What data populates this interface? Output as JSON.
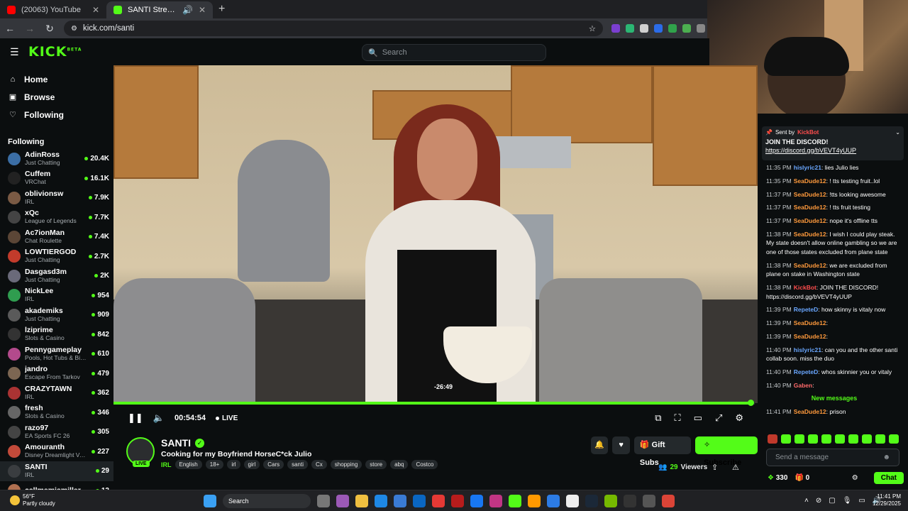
{
  "browser": {
    "tabs": [
      {
        "title": "(20063) YouTube",
        "favicon": "youtube-icon",
        "color": "#ff0000",
        "active": false
      },
      {
        "title": "SANTI Stream - Watch Live",
        "favicon": "kick-icon",
        "color": "#53fc18",
        "active": true
      }
    ],
    "url": "kick.com/santi"
  },
  "header": {
    "logo": "KICK",
    "logo_tag": "BETA",
    "search_placeholder": "Search"
  },
  "sidebar": {
    "nav": [
      {
        "label": "Home",
        "icon": "home-icon"
      },
      {
        "label": "Browse",
        "icon": "browse-icon"
      },
      {
        "label": "Following",
        "icon": "heart-icon"
      }
    ],
    "following_title": "Following",
    "channels": [
      {
        "name": "AdinRoss",
        "category": "Just Chatting",
        "viewers": "20.4K",
        "color": "#3b6ea5"
      },
      {
        "name": "Cuffem",
        "category": "VRChat",
        "viewers": "16.1K",
        "color": "#222"
      },
      {
        "name": "oblivionsw",
        "category": "IRL",
        "viewers": "7.9K",
        "color": "#7a5a44"
      },
      {
        "name": "xQc",
        "category": "League of Legends",
        "viewers": "7.7K",
        "color": "#444"
      },
      {
        "name": "Ac7ionMan",
        "category": "Chat Roulette",
        "viewers": "7.4K",
        "color": "#5b4636"
      },
      {
        "name": "LOWTIERGOD",
        "category": "Just Chatting",
        "viewers": "2.7K",
        "color": "#c23b2b"
      },
      {
        "name": "Dasgasd3m",
        "category": "Just Chatting",
        "viewers": "2K",
        "color": "#6a6a7a"
      },
      {
        "name": "NickLee",
        "category": "IRL",
        "viewers": "954",
        "color": "#2f9d4f"
      },
      {
        "name": "akademiks",
        "category": "Just Chatting",
        "viewers": "909",
        "color": "#5a5a5a"
      },
      {
        "name": "lziprime",
        "category": "Slots & Casino",
        "viewers": "842",
        "color": "#333"
      },
      {
        "name": "Pennygameplay",
        "category": "Pools, Hot Tubs & Biki...",
        "viewers": "610",
        "color": "#b34a8c"
      },
      {
        "name": "jandro",
        "category": "Escape From Tarkov",
        "viewers": "479",
        "color": "#7c6652"
      },
      {
        "name": "CRAZYTAWN",
        "category": "IRL",
        "viewers": "362",
        "color": "#a33"
      },
      {
        "name": "fresh",
        "category": "Slots & Casino",
        "viewers": "346",
        "color": "#666"
      },
      {
        "name": "razo97",
        "category": "EA Sports FC 26",
        "viewers": "305",
        "color": "#444"
      },
      {
        "name": "Amouranth",
        "category": "Disney Dreamlight Vall...",
        "viewers": "227",
        "color": "#c24a3a"
      },
      {
        "name": "SANTI",
        "category": "IRL",
        "viewers": "29",
        "color": "#3a3d40",
        "selected": true
      },
      {
        "name": "callmemiamiller",
        "category": "",
        "viewers": "12",
        "color": "#b07050"
      }
    ]
  },
  "player": {
    "hover_time": "-26:49",
    "elapsed": "00:54:54",
    "live_label": "LIVE",
    "progress": 0.995
  },
  "stream": {
    "name": "SANTI",
    "live_badge": "LIVE",
    "title": "Cooking for my Boyfriend HorseC*ck Julio",
    "category": "IRL",
    "tags": [
      "English",
      "18+",
      "irl",
      "girl",
      "Cars",
      "santi",
      "Cx",
      "shopping",
      "store",
      "abq",
      "Costco"
    ],
    "gift_label": "Gift Subs",
    "subscribe_label": "Subscribe",
    "viewer_count": "29",
    "viewer_label": "Viewers"
  },
  "chat": {
    "pinned": {
      "sent_by": "Sent by",
      "bot": "KickBot",
      "text": "JOIN THE DISCORD!",
      "link": "https://discord.gg/bVEVT4yUUP"
    },
    "messages": [
      {
        "time": "11:35 PM",
        "user": "hislyric21",
        "color": "#6aa7ff",
        "text": ": lies Julio lies"
      },
      {
        "time": "11:35 PM",
        "user": "SeaDude12",
        "color": "#ff9a3c",
        "text": ": ! tts testing fruit..lol"
      },
      {
        "time": "11:37 PM",
        "user": "SeaDude12",
        "color": "#ff9a3c",
        "text": ": !tts looking awesome"
      },
      {
        "time": "11:37 PM",
        "user": "SeaDude12",
        "color": "#ff9a3c",
        "text": ": ! tts fruit testing"
      },
      {
        "time": "11:37 PM",
        "user": "SeaDude12",
        "color": "#ff9a3c",
        "text": ": nope it's offline tts"
      },
      {
        "time": "11:38 PM",
        "user": "SeaDude12",
        "color": "#ff9a3c",
        "text": ": I wish I could play steak. My state doesn't allow online gambling so we are one of those states excluded from plane state"
      },
      {
        "time": "11:38 PM",
        "user": "SeaDude12",
        "color": "#ff9a3c",
        "text": ": we are excluded from plane on stake in Washington state"
      },
      {
        "time": "11:38 PM",
        "user": "KickBot",
        "color": "#ff4d4d",
        "text": ": JOIN THE DISCORD! https://discord.gg/bVEVT4yUUP"
      },
      {
        "time": "11:39 PM",
        "user": "RepeteD",
        "color": "#6aa7ff",
        "text": ": how skinny is vitaly now"
      },
      {
        "time": "11:39 PM",
        "user": "SeaDude12",
        "color": "#ff9a3c",
        "text": ":"
      },
      {
        "time": "11:39 PM",
        "user": "SeaDude12",
        "color": "#ff9a3c",
        "text": ":"
      },
      {
        "time": "11:40 PM",
        "user": "hislyric21",
        "color": "#6aa7ff",
        "text": ": can you and the other santi collab soon. miss the duo"
      },
      {
        "time": "11:40 PM",
        "user": "RepeteD",
        "color": "#6aa7ff",
        "text": ": whos skinnier you or vitaly"
      },
      {
        "time": "11:40 PM",
        "user": "Gaben",
        "color": "#ff6a6a",
        "text": ":"
      }
    ],
    "new_messages": "New messages",
    "last": {
      "time": "11:41 PM",
      "user": "SeaDude12",
      "color": "#ff9a3c",
      "text": ": prison"
    },
    "input_placeholder": "Send a message",
    "points": "330",
    "gifts": "0",
    "chat_button": "Chat"
  },
  "taskbar": {
    "weather_temp": "56°F",
    "weather_desc": "Partly cloudy",
    "search": "Search",
    "time": "11:41 PM",
    "date": "12/29/2025"
  }
}
